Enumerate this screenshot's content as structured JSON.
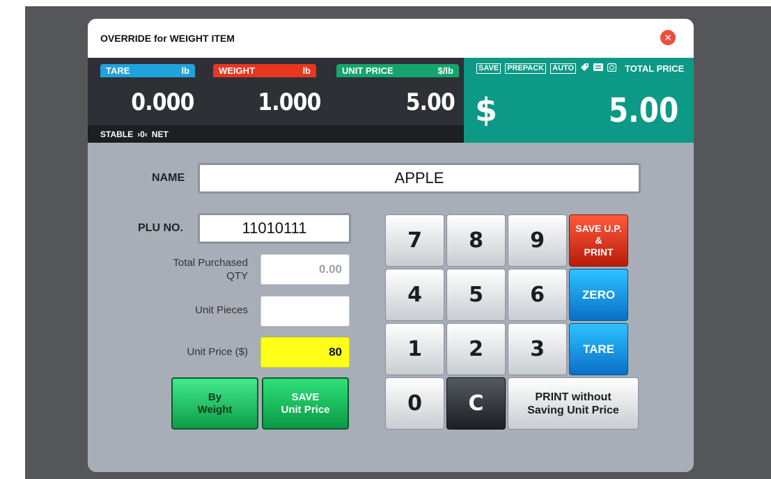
{
  "dialog": {
    "title": "OVERRIDE for WEIGHT ITEM",
    "close_symbol": "✕"
  },
  "scale": {
    "tare": {
      "label": "TARE",
      "unit": "lb",
      "value": "0.000"
    },
    "weight": {
      "label": "WEIGHT",
      "unit": "lb",
      "value": "1.000"
    },
    "unit_price": {
      "label": "UNIT PRICE",
      "unit": "$/lb",
      "value": "5.00"
    },
    "status": {
      "stable": "STABLE",
      "zero_symbol": "›0‹",
      "net": "NET"
    },
    "flags": [
      "SAVE",
      "PREPACK",
      "AUTO"
    ],
    "total_price": {
      "label": "TOTAL PRICE",
      "currency": "$",
      "value": "5.00"
    },
    "colors": {
      "tare": "#1fa3dc",
      "weight": "#e8361f",
      "unit_price": "#15a46d",
      "total_bg": "#0c9a86"
    }
  },
  "form": {
    "name_label": "NAME",
    "name_value": "APPLE",
    "plu_label": "PLU NO.",
    "plu_value": "11010111",
    "total_qty_label": "Total Purchased QTY",
    "total_qty_value": "0.00",
    "unit_pieces_label": "Unit Pieces",
    "unit_pieces_value": "",
    "unit_price_label": "Unit Price ($)",
    "unit_price_value": "80"
  },
  "buttons": {
    "by_weight": {
      "line1": "By",
      "line2": "Weight"
    },
    "save_unit_price": {
      "line1": "SAVE",
      "line2": "Unit Price"
    }
  },
  "keypad": {
    "k7": "7",
    "k8": "8",
    "k9": "9",
    "k4": "4",
    "k5": "5",
    "k6": "6",
    "k1": "1",
    "k2": "2",
    "k3": "3",
    "k0": "0",
    "clear": "C",
    "save_up_print": {
      "line1": "SAVE U.P.",
      "line2": "&",
      "line3": "PRINT"
    },
    "zero": "ZERO",
    "tare": "TARE",
    "print_without": {
      "line1": "PRINT without",
      "line2": "Saving Unit Price"
    }
  }
}
